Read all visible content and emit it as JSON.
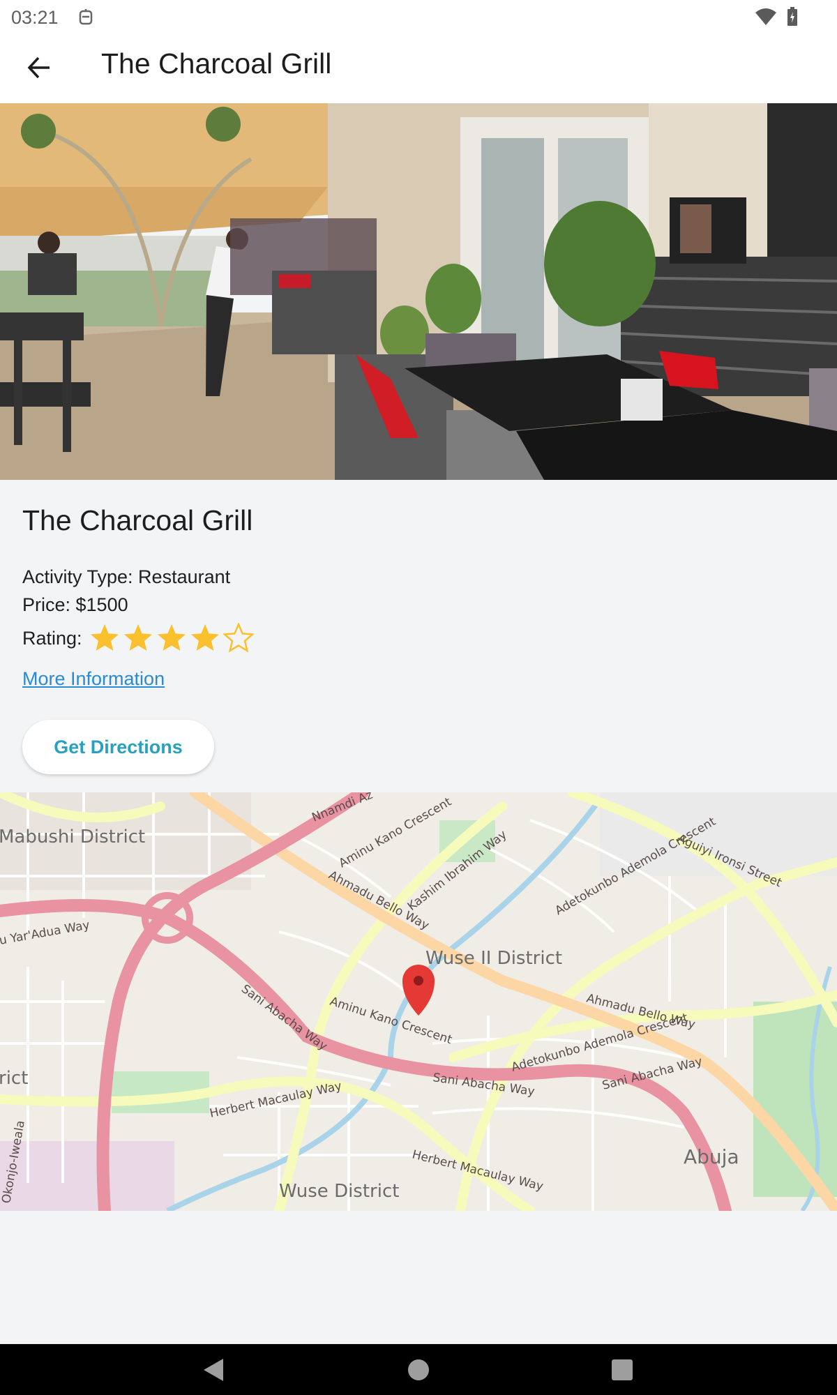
{
  "status_bar": {
    "time": "03:21"
  },
  "app_bar": {
    "title": "The Charcoal Grill"
  },
  "place": {
    "name": "The Charcoal Grill",
    "activity_type": "Activity Type: Restaurant",
    "price": "Price: $1500",
    "rating_label": "Rating:",
    "rating": 4,
    "rating_max": 5,
    "more_info": "More Information",
    "directions": "Get Directions"
  },
  "map": {
    "labels": {
      "wuse2": "Wuse II District",
      "wuse": "Wuse District",
      "mabushi": "Mabushi District",
      "abuja": "Abuja",
      "rict": "rict",
      "nnamdi": "Nnamdi Az",
      "aminu1": "Aminu Kano Crescent",
      "kashim": "Kashim Ibrahim Way",
      "ahmadu1": "Ahmadu Bello Way",
      "ahmadu2": "Ahmadu Bello Way",
      "yaradua": "u Yar'Adua Way",
      "sani1": "Sani Abacha Way",
      "sani2": "Sani Abacha Way",
      "sani3": "Sani Abacha Way",
      "aminu2": "Aminu Kano Crescent",
      "adetokunbo1": "Adetokunbo Ademola Crescent",
      "adetokunbo2": "Adetokunbo Ademola Crescent",
      "aguiyi": "Aguiyi Ironsi Street",
      "herbert1": "Herbert Macaulay Way",
      "herbert2": "Herbert Macaulay Way",
      "okonjo": "Okonjo-Iweala"
    },
    "colors": {
      "primary_road": "#e892a2",
      "secondary_road": "#f6fabb",
      "trunk": "#fcd6a4",
      "marker": "#e53935"
    }
  },
  "colors": {
    "accent": "#2aa0c0",
    "link": "#2a8ad4",
    "star": "#fbc02d",
    "background": "#f3f4f6"
  }
}
